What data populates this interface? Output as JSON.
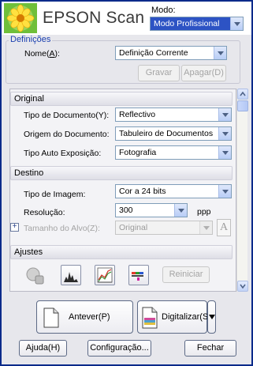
{
  "header": {
    "title": "EPSON Scan",
    "mode_label": "Modo:",
    "mode_value": "Modo Profissional"
  },
  "settings": {
    "group_title": "Definições",
    "name_label_pre": "Nome(",
    "name_label_key": "A",
    "name_label_post": "):",
    "name_value": "Definição Corrente",
    "save_label": "Gravar",
    "delete_label": "Apagar(D)"
  },
  "original": {
    "title": "Original",
    "doc_type_label": "Tipo de Documento(Y):",
    "doc_type_value": "Reflectivo",
    "doc_source_label": "Origem do Documento:",
    "doc_source_value": "Tabuleiro de Documentos",
    "auto_exposure_label": "Tipo Auto Exposição:",
    "auto_exposure_value": "Fotografia"
  },
  "destination": {
    "title": "Destino",
    "image_type_label": "Tipo de Imagem:",
    "image_type_value": "Cor a 24 bits",
    "resolution_label": "Resolução:",
    "resolution_value": "300",
    "resolution_unit": "ppp",
    "target_size_label": "Tamanho do Alvo(Z):",
    "target_size_value": "Original"
  },
  "adjustments": {
    "title": "Ajustes",
    "reset_label": "Reiniciar"
  },
  "actions": {
    "preview_label": "Antever(P)",
    "scan_label": "Digitalizar(S)"
  },
  "footer": {
    "help_label": "Ajuda(H)",
    "config_label": "Configuração...",
    "close_label": "Fechar"
  }
}
